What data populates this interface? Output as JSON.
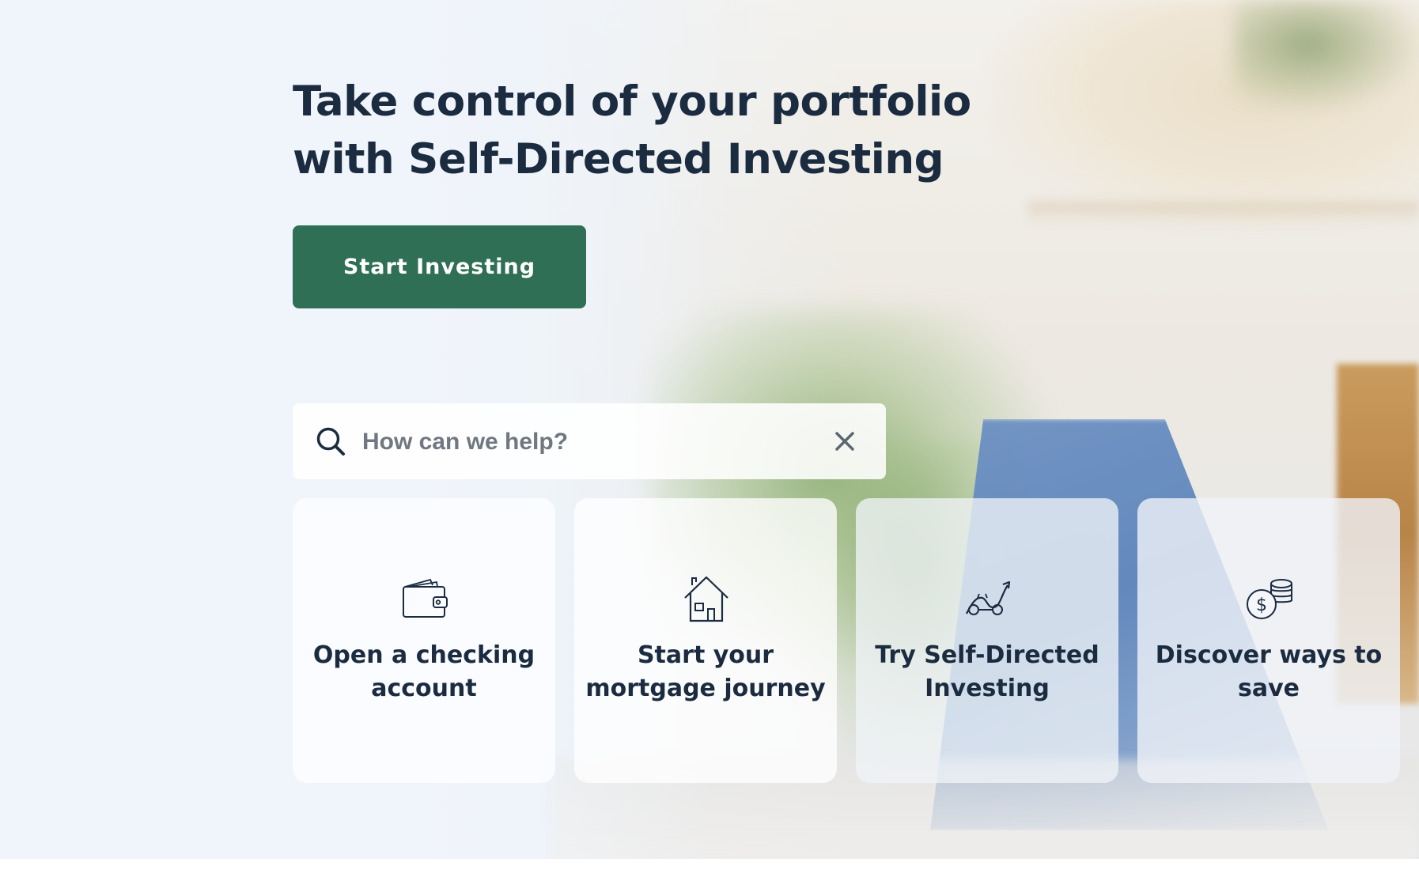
{
  "hero": {
    "headline_line1": "Take control of your portfolio",
    "headline_line2": "with Self-Directed Investing",
    "cta_label": "Start Investing"
  },
  "search": {
    "placeholder": "How can we help?",
    "search_icon": "search-icon",
    "clear_icon": "close-icon"
  },
  "tiles": [
    {
      "label": "Open a checking account",
      "icon": "wallet-icon"
    },
    {
      "label": "Start your mortgage journey",
      "icon": "house-icon"
    },
    {
      "label": "Try Self-Directed Investing",
      "icon": "investing-chart-icon"
    },
    {
      "label": "Discover ways to save",
      "icon": "coins-icon"
    }
  ],
  "colors": {
    "heading": "#1b2b40",
    "cta_background": "#2f6f55",
    "cta_text": "#ffffff",
    "placeholder": "#707780"
  }
}
